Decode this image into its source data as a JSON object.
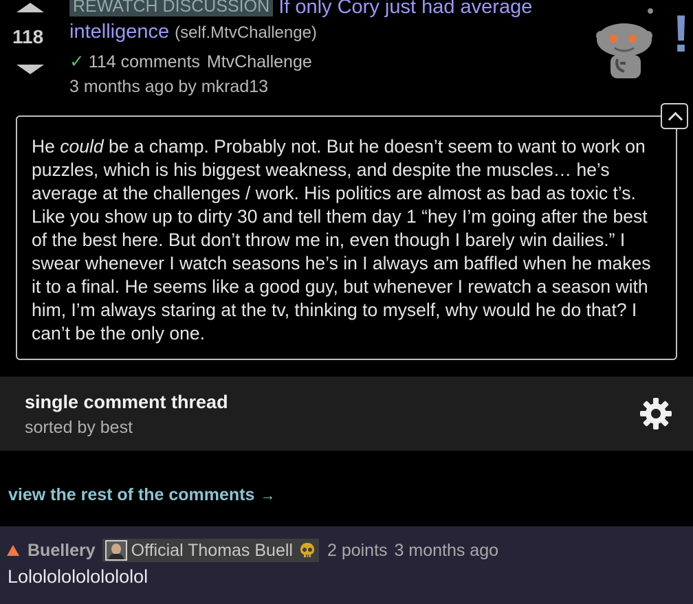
{
  "post": {
    "score": "118",
    "flair": "REWATCH DISCUSSION",
    "title": "If only Cory just had average intelligence",
    "domain": "(self.MtvChallenge)",
    "comments_label": "114 comments",
    "subreddit": "MtvChallenge",
    "byline": "3 months ago by mkrad13",
    "selftext_before": "He ",
    "selftext_em": "could",
    "selftext_after": " be a champ. Probably not. But he doesn’t seem to want to work on puzzles, which is his biggest weakness, and despite the muscles… he’s average at the challenges / work. His politics are almost as bad as toxic t’s. Like you show up to dirty 30 and tell them day 1 “hey I’m going after the best of the best here. But don’t throw me in, even though I barely win dailies.” I swear whenever I watch seasons he’s in I always am baffled when he makes it to a final. He seems like a good guy, but whenever I rewatch a season with him, I’m always staring at the tv, thinking to myself, why would he do that? I can’t be the only one.",
    "exclaim": "!"
  },
  "thread": {
    "title": "single comment thread",
    "sort": "sorted by best"
  },
  "view_rest": {
    "label": "view the rest of the comments",
    "arrow": "→"
  },
  "comment": {
    "author": "Buellery",
    "flair_text": "Official Thomas Buell",
    "points": "2 points",
    "time": "3 months ago",
    "body": "Lololololololololol"
  },
  "colors": {
    "title_link": "#9a9af6",
    "flair_bg": "#3b4a4d",
    "check": "#5cb85c",
    "view_rest": "#8ec3d0",
    "upvote": "#f07848",
    "comment_bg": "#282438"
  },
  "icons": {
    "upvote": "arrow-up-icon",
    "downvote": "arrow-down-icon",
    "check": "check-icon",
    "mascot": "snoo-icon",
    "collapse": "chevron-up-icon",
    "settings": "gear-icon",
    "flair_skull": "skull-icon"
  }
}
